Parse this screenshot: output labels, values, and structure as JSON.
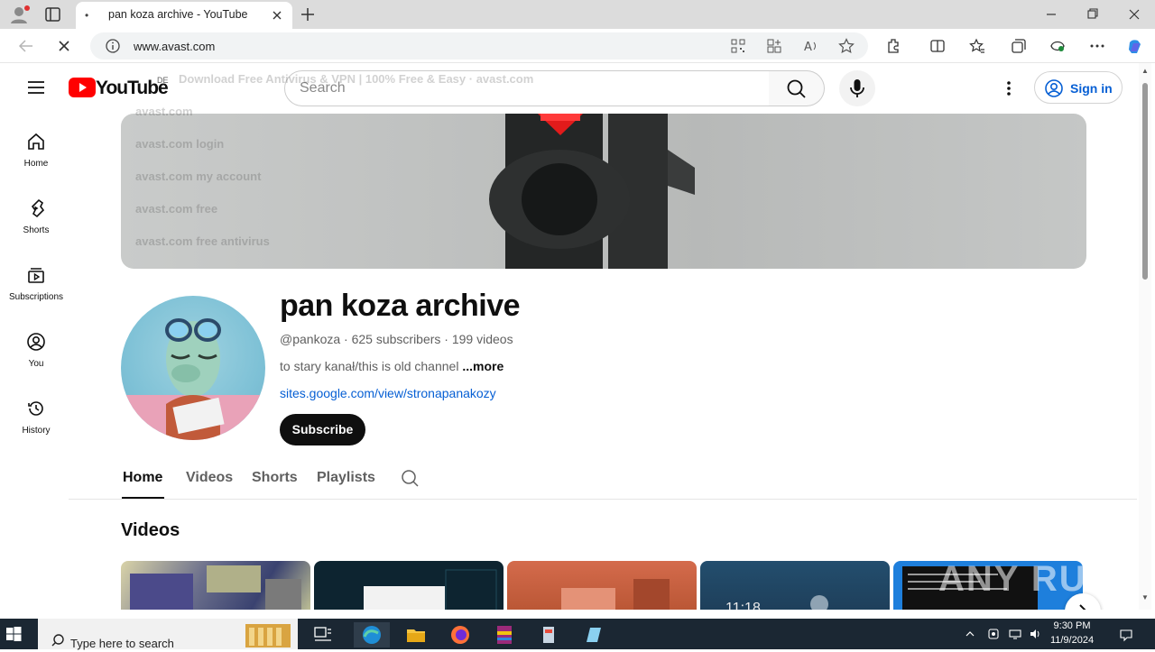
{
  "browser": {
    "tab_title": "pan koza archive - YouTube",
    "tab_favicon": "•",
    "url": "www.avast.com"
  },
  "youtube": {
    "logo_text": "YouTube",
    "region": "DE",
    "search_placeholder": "Search",
    "signin_label": "Sign in",
    "autocomplete_ghost": [
      "Download Free Antivirus & VPN | 100% Free & Easy · avast.com",
      "avast.com",
      "avast.com login",
      "avast.com my account",
      "avast.com free",
      "avast.com free antivirus"
    ],
    "guide": [
      {
        "label": "Home",
        "icon": "home-icon"
      },
      {
        "label": "Shorts",
        "icon": "shorts-icon"
      },
      {
        "label": "Subscriptions",
        "icon": "subscriptions-icon"
      },
      {
        "label": "You",
        "icon": "you-icon"
      },
      {
        "label": "History",
        "icon": "history-icon"
      }
    ],
    "channel": {
      "name": "pan koza archive",
      "meta": "@pankoza · 625 subscribers · 199 videos",
      "description": "to stary kanał/this is old channel ",
      "description_more": "...more",
      "link": "sites.google.com/view/stronapanakozy",
      "subscribe_label": "Subscribe"
    },
    "tabs": [
      "Home",
      "Videos",
      "Shorts",
      "Playlists"
    ],
    "active_tab": "Home",
    "section_title": "Videos",
    "thumb_time": "11:18"
  },
  "watermark": "ANY RUN",
  "taskbar": {
    "search_text": "Type here to search",
    "time": "9:30 PM",
    "date": "11/9/2024"
  },
  "colors": {
    "youtube_red": "#ff0000",
    "link_blue": "#065fd4",
    "taskbar": "#1b2733"
  }
}
